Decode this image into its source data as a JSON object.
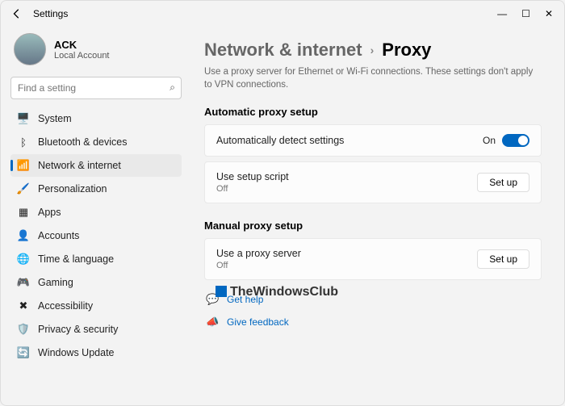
{
  "window": {
    "title": "Settings"
  },
  "user": {
    "name": "ACK",
    "subtitle": "Local Account"
  },
  "search": {
    "placeholder": "Find a setting"
  },
  "nav": [
    {
      "label": "System",
      "icon": "🖥️"
    },
    {
      "label": "Bluetooth & devices",
      "icon": "ᛒ"
    },
    {
      "label": "Network & internet",
      "icon": "📶",
      "active": true
    },
    {
      "label": "Personalization",
      "icon": "🖌️"
    },
    {
      "label": "Apps",
      "icon": "▦"
    },
    {
      "label": "Accounts",
      "icon": "👤"
    },
    {
      "label": "Time & language",
      "icon": "🌐"
    },
    {
      "label": "Gaming",
      "icon": "🎮"
    },
    {
      "label": "Accessibility",
      "icon": "✖"
    },
    {
      "label": "Privacy & security",
      "icon": "🛡️"
    },
    {
      "label": "Windows Update",
      "icon": "🔄"
    }
  ],
  "breadcrumb": {
    "parent": "Network & internet",
    "current": "Proxy"
  },
  "description": "Use a proxy server for Ethernet or Wi-Fi connections. These settings don't apply to VPN connections.",
  "auto": {
    "title": "Automatic proxy setup",
    "detect": {
      "label": "Automatically detect settings",
      "state": "On"
    },
    "script": {
      "label": "Use setup script",
      "state": "Off",
      "button": "Set up"
    }
  },
  "manual": {
    "title": "Manual proxy setup",
    "proxy": {
      "label": "Use a proxy server",
      "state": "Off",
      "button": "Set up"
    }
  },
  "links": {
    "help": "Get help",
    "feedback": "Give feedback"
  },
  "watermark": "TheWindowsClub"
}
